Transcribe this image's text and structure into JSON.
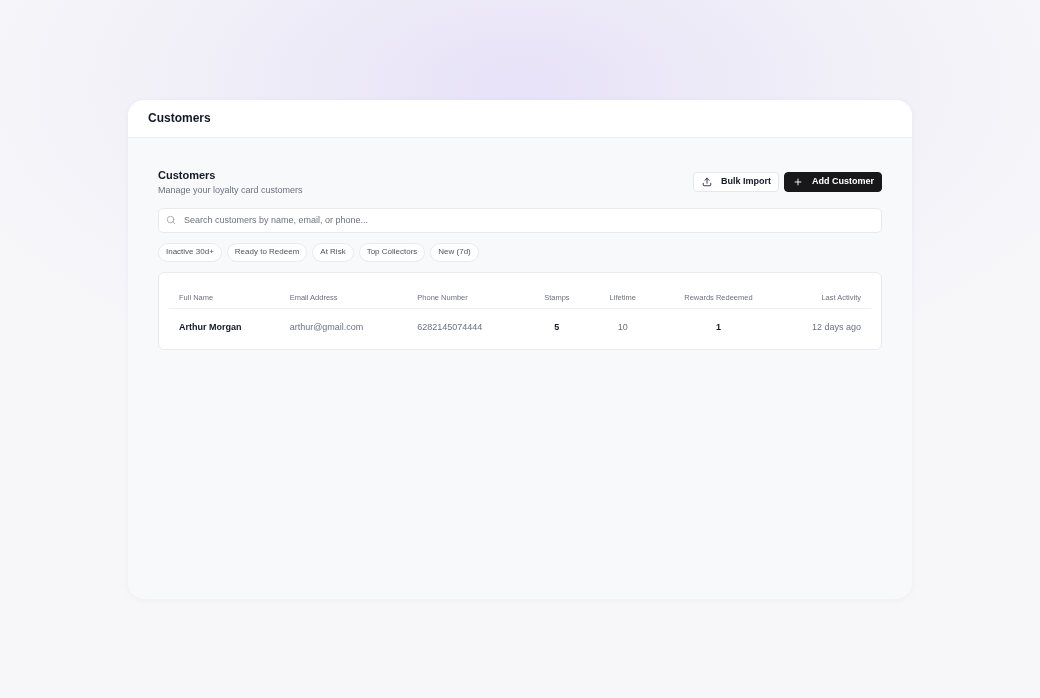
{
  "page": {
    "title": "Customers"
  },
  "section": {
    "title": "Customers",
    "subtitle": "Manage your loyalty card customers"
  },
  "actions": [
    {
      "kind": "secondary",
      "label": "Bulk Import"
    },
    {
      "kind": "primary",
      "label": "Add Customer"
    }
  ],
  "search": {
    "placeholder": "Search customers by name, email, or phone..."
  },
  "filters": [
    {
      "label": "Inactive 30d+",
      "selected": false
    },
    {
      "label": "Ready to Redeem",
      "selected": false
    },
    {
      "label": "At Risk",
      "selected": false
    },
    {
      "label": "Top Collectors",
      "selected": false
    },
    {
      "label": "New (7d)",
      "selected": false
    }
  ],
  "table": {
    "columns": [
      "Full Name",
      "Email Address",
      "Phone Number",
      "Stamps",
      "Lifetime",
      "Rewards Redeemed",
      "Last Activity"
    ],
    "rows": [
      {
        "cells": [
          "Arthur Morgan",
          "arthur@gmail.com",
          "6282145074444",
          "5",
          "10",
          "1",
          "12 days ago"
        ]
      }
    ]
  }
}
